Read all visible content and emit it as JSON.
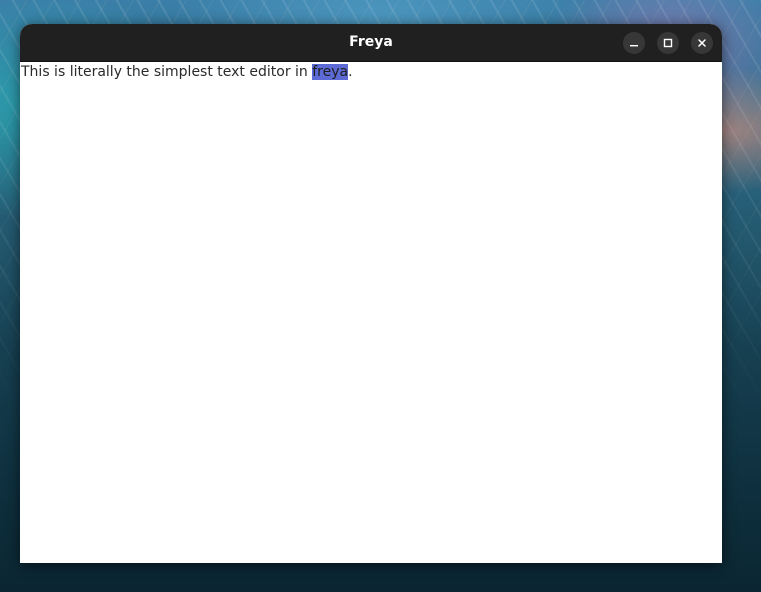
{
  "window": {
    "title": "Freya"
  },
  "titlebar_buttons": {
    "minimize_icon": "minimize-icon",
    "maximize_icon": "maximize-icon",
    "close_icon": "close-icon"
  },
  "editor": {
    "text_before": "This is literally the simplest text editor in ",
    "selected_text": "freya",
    "text_after": ".",
    "selection_color": "#5b6ad4"
  }
}
